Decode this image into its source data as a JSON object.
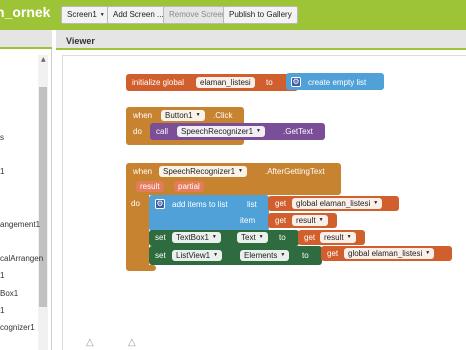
{
  "topbar": {
    "project": "n_ornek",
    "screen_btn": "Screen1",
    "add_screen": "Add Screen ...",
    "remove_screen": "Remove Screen",
    "publish": "Publish to Gallery"
  },
  "components": {
    "items": [
      "s",
      "1",
      "angement1",
      "calArrangen",
      "1",
      "Box1",
      "1",
      "cognizer1"
    ]
  },
  "viewer": {
    "title": "Viewer"
  },
  "blocks": {
    "init": {
      "label": "initialize global",
      "var": "elaman_listesi",
      "to": "to",
      "value": "create empty list"
    },
    "click": {
      "when": "when",
      "comp": "Button1",
      "event": ".Click",
      "do": "do",
      "call": "call",
      "call_comp": "SpeechRecognizer1",
      "method": ".GetText"
    },
    "after": {
      "when": "when",
      "comp": "SpeechRecognizer1",
      "event": ".AfterGettingText",
      "p1": "result",
      "p2": "partial",
      "do": "do",
      "add": "add items to list",
      "list": "list",
      "get": "get",
      "glist": "global elaman_listesi",
      "item": "item",
      "result": "result",
      "set": "set",
      "tb": "TextBox1",
      "text": "Text",
      "to": "to",
      "lv": "ListView1",
      "elements": "Elements",
      "gvar": "global elaman_listesi"
    }
  },
  "colors": {
    "topbar": "#9dc436",
    "variable": "#d05f2d",
    "event": "#c88330",
    "procedure": "#7b4f97",
    "list": "#4fa1d8",
    "setter": "#2e6b3e",
    "getter": "#e47b5a"
  }
}
